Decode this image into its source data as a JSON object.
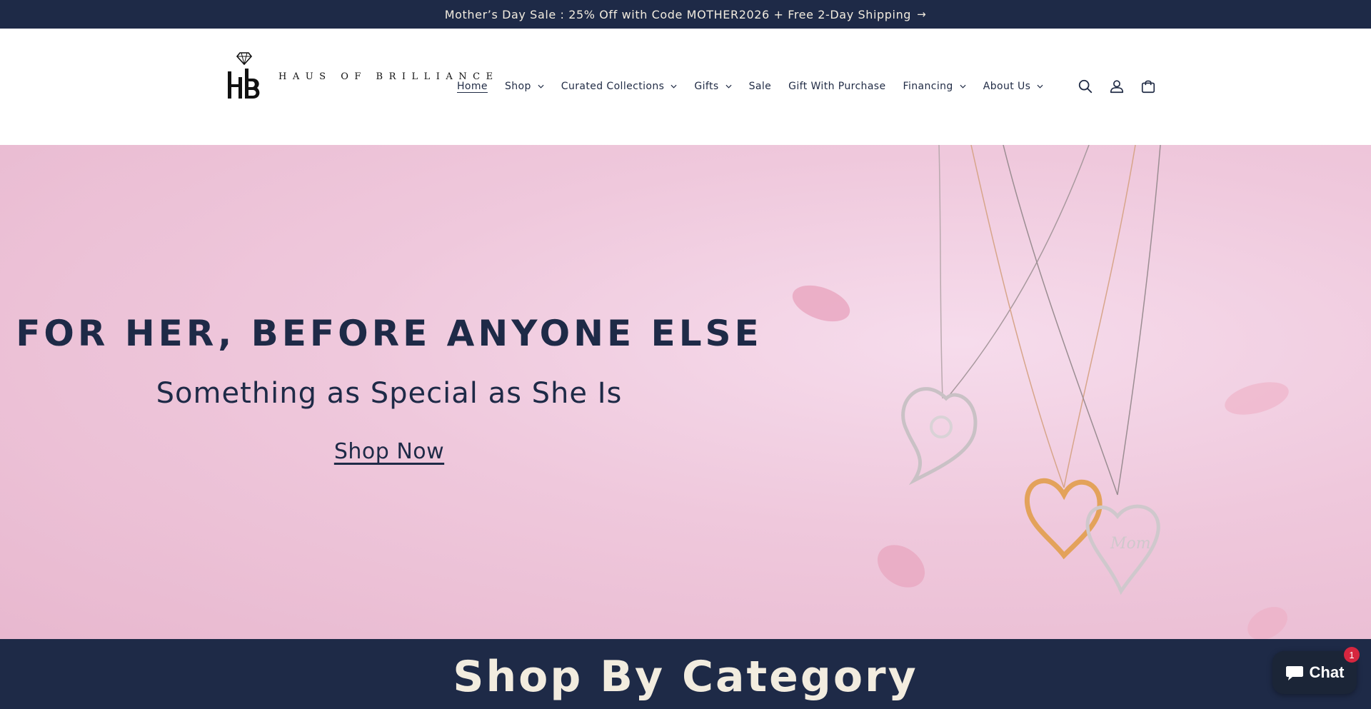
{
  "announcement": {
    "text": "Mother’s Day Sale : 25% Off with Code MOTHER2026 + Free 2-Day Shipping",
    "arrow": "→"
  },
  "brand": {
    "name": "HAUS OF BRILLIANCE",
    "monogram": "HB"
  },
  "nav": {
    "items": [
      {
        "label": "Home",
        "active": true,
        "has_dropdown": false
      },
      {
        "label": "Shop",
        "active": false,
        "has_dropdown": true
      },
      {
        "label": "Curated Collections",
        "active": false,
        "has_dropdown": true
      },
      {
        "label": "Gifts",
        "active": false,
        "has_dropdown": true
      },
      {
        "label": "Sale",
        "active": false,
        "has_dropdown": false
      },
      {
        "label": "Gift With Purchase",
        "active": false,
        "has_dropdown": false
      },
      {
        "label": "Financing",
        "active": false,
        "has_dropdown": true
      },
      {
        "label": "About Us",
        "active": false,
        "has_dropdown": true
      }
    ]
  },
  "header_icons": [
    "search-icon",
    "account-icon",
    "cart-icon"
  ],
  "hero": {
    "title": "FOR HER, BEFORE ANYONE ELSE",
    "subtitle": "Something as Special as She Is",
    "cta": "Shop Now"
  },
  "category": {
    "title": "Shop By Category"
  },
  "chat": {
    "label": "Chat",
    "badge": "1"
  },
  "colors": {
    "navy": "#1e2a47",
    "cream": "#f2ecdf",
    "hero_pink": "#efc8dc",
    "badge_red": "#d6263f"
  }
}
